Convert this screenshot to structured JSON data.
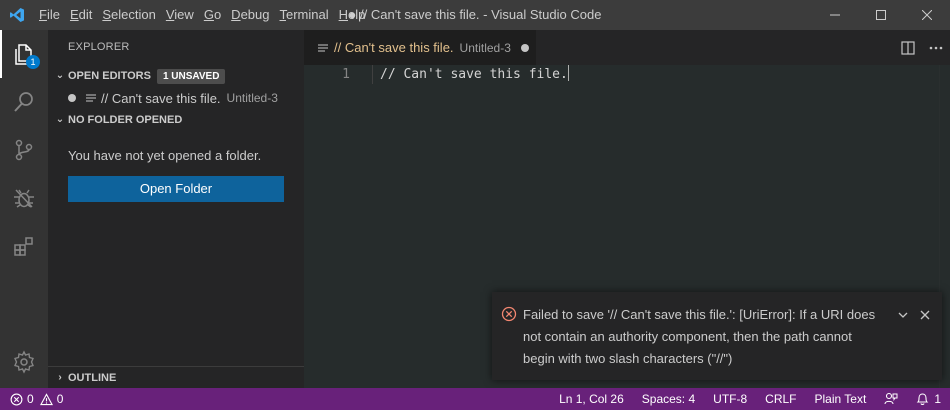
{
  "titlebar": {
    "menu": [
      "File",
      "Edit",
      "Selection",
      "View",
      "Go",
      "Debug",
      "Terminal",
      "Help"
    ],
    "menu_mnemonics": [
      "F",
      "E",
      "S",
      "V",
      "G",
      "D",
      "T",
      "H"
    ],
    "menu_rest": [
      "ile",
      "dit",
      "election",
      "iew",
      "o",
      "ebug",
      "erminal",
      "elp"
    ],
    "window_title": "● // Can't save this file. - Visual Studio Code"
  },
  "activity_bar": {
    "items": [
      "files-icon",
      "search-icon",
      "source-control-icon",
      "debug-icon",
      "extensions-icon"
    ],
    "explorer_badge": "1",
    "bottom": "settings-gear-icon"
  },
  "sidebar": {
    "title": "EXPLORER",
    "open_editors": {
      "header": "OPEN EDITORS",
      "badge": "1 UNSAVED",
      "items": [
        {
          "label": "// Can't save this file.",
          "description": "Untitled-3"
        }
      ]
    },
    "no_folder": {
      "header": "NO FOLDER OPENED",
      "message": "You have not yet opened a folder.",
      "button": "Open Folder"
    },
    "outline_header": "OUTLINE"
  },
  "editor": {
    "tab": {
      "label": "// Can't save this file.",
      "description": "Untitled-3"
    },
    "lines": [
      {
        "number": "1",
        "text": "// Can't save this file."
      }
    ]
  },
  "notification": {
    "message": "Failed to save '// Can't save this file.': [UriError]: If a URI does not contain an authority component, then the path cannot begin with two slash characters (\"//\")"
  },
  "statusbar": {
    "errors": "0",
    "warnings": "0",
    "position": "Ln 1, Col 26",
    "spaces": "Spaces: 4",
    "encoding": "UTF-8",
    "eol": "CRLF",
    "language": "Plain Text",
    "notifications": "1"
  },
  "colors": {
    "accent": "#007acc",
    "statusbar": "#68217a",
    "button": "#0e639c",
    "error": "#f48771",
    "modified_tab": "#e2c08d"
  }
}
